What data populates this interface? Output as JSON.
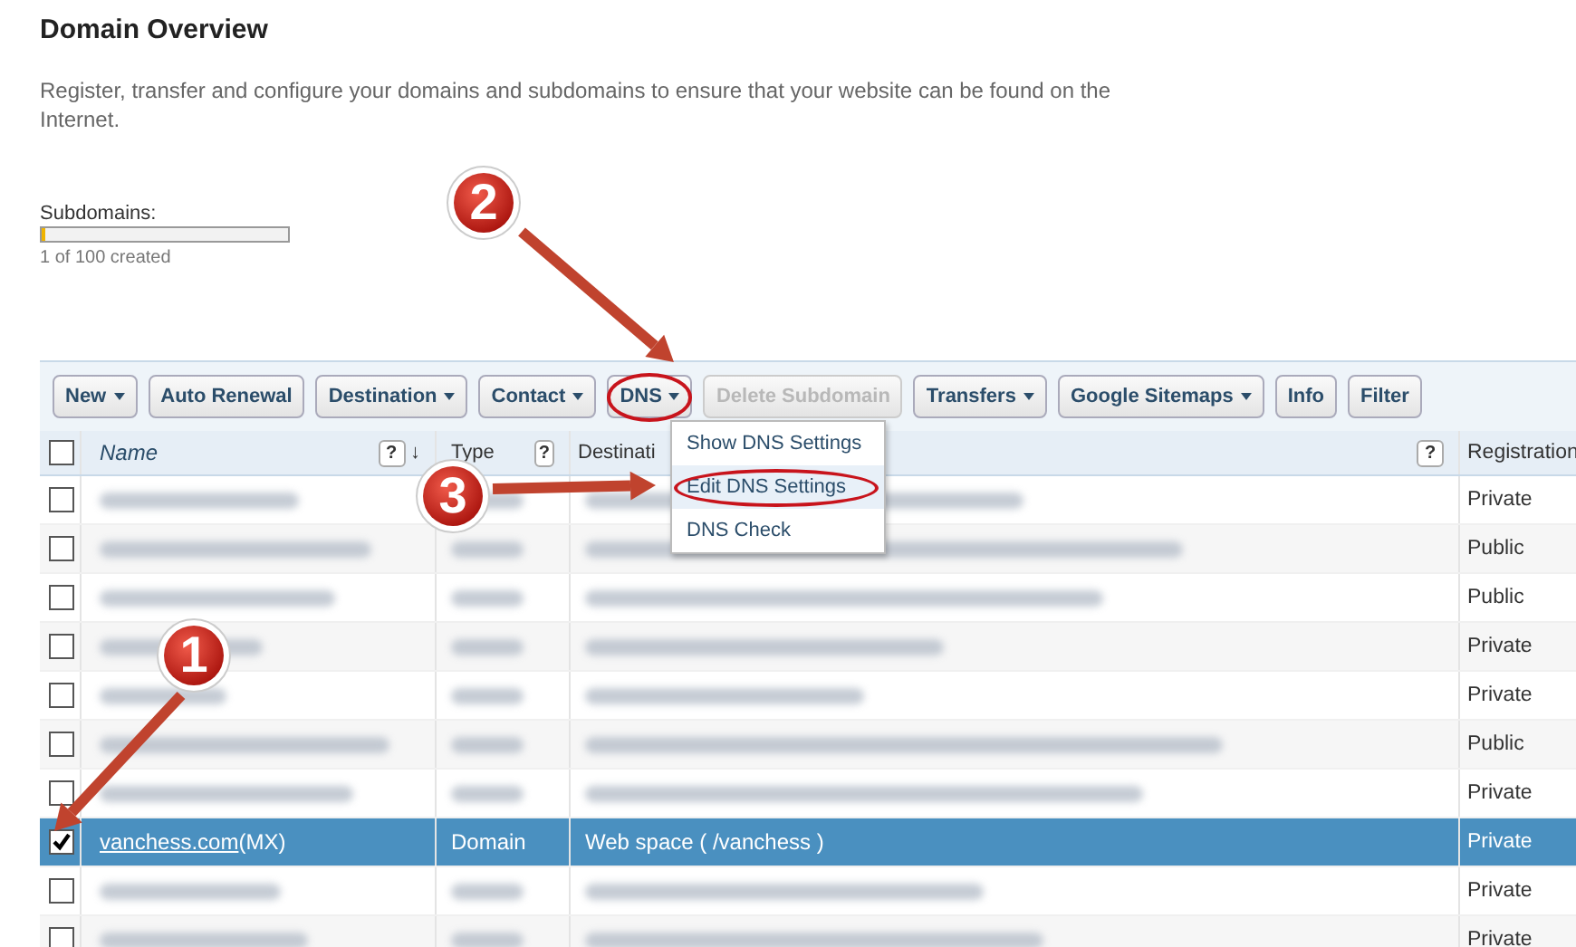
{
  "title": "Domain Overview",
  "description": "Register, transfer and configure your domains and subdomains to ensure that your website can be found on the Internet.",
  "subdomains": {
    "label": "Subdomains:",
    "level": 0.01,
    "caption": "1 of 100 created"
  },
  "toolbar": [
    {
      "label": "New",
      "dropdown": true,
      "disabled": false,
      "circled": false
    },
    {
      "label": "Auto Renewal",
      "dropdown": false,
      "disabled": false,
      "circled": false
    },
    {
      "label": "Destination",
      "dropdown": true,
      "disabled": false,
      "circled": false
    },
    {
      "label": "Contact",
      "dropdown": true,
      "disabled": false,
      "circled": false
    },
    {
      "label": "DNS",
      "dropdown": true,
      "disabled": false,
      "circled": true
    },
    {
      "label": "Delete Subdomain",
      "dropdown": false,
      "disabled": true,
      "circled": false
    },
    {
      "label": "Transfers",
      "dropdown": true,
      "disabled": false,
      "circled": false
    },
    {
      "label": "Google Sitemaps",
      "dropdown": true,
      "disabled": false,
      "circled": false
    },
    {
      "label": "Info",
      "dropdown": false,
      "disabled": false,
      "circled": false
    },
    {
      "label": "Filter",
      "dropdown": false,
      "disabled": false,
      "circled": false
    }
  ],
  "dns_menu": [
    {
      "label": "Show DNS Settings",
      "selected": false,
      "circled": false
    },
    {
      "label": "Edit DNS Settings",
      "selected": true,
      "circled": true
    },
    {
      "label": "DNS Check",
      "selected": false,
      "circled": false
    }
  ],
  "table": {
    "all_checked": false,
    "columns": [
      {
        "label": "Name",
        "help": "?",
        "sort": "↓"
      },
      {
        "label": "Type",
        "help": "?"
      },
      {
        "label": "Destinati",
        "help": "?"
      },
      {
        "label": "Registration"
      }
    ],
    "rows": [
      {
        "blurred": true,
        "checked": false,
        "selected": false,
        "registration": "Private"
      },
      {
        "blurred": true,
        "checked": false,
        "selected": false,
        "registration": "Public"
      },
      {
        "blurred": true,
        "checked": false,
        "selected": false,
        "registration": "Public"
      },
      {
        "blurred": true,
        "checked": false,
        "selected": false,
        "registration": "Private"
      },
      {
        "blurred": true,
        "checked": false,
        "selected": false,
        "registration": "Private"
      },
      {
        "blurred": true,
        "checked": false,
        "selected": false,
        "registration": "Public"
      },
      {
        "blurred": true,
        "checked": false,
        "selected": false,
        "registration": "Private"
      },
      {
        "blurred": false,
        "checked": true,
        "selected": true,
        "name": "vanchess.com",
        "suffix": "(MX)",
        "type": "Domain",
        "destination": "Web space ( /vanchess )",
        "registration": "Private"
      },
      {
        "blurred": true,
        "checked": false,
        "selected": false,
        "registration": "Private"
      },
      {
        "blurred": true,
        "checked": false,
        "selected": false,
        "registration": "Private"
      }
    ]
  },
  "annotations": [
    {
      "label": "2"
    },
    {
      "label": "3"
    },
    {
      "label": "1"
    }
  ]
}
